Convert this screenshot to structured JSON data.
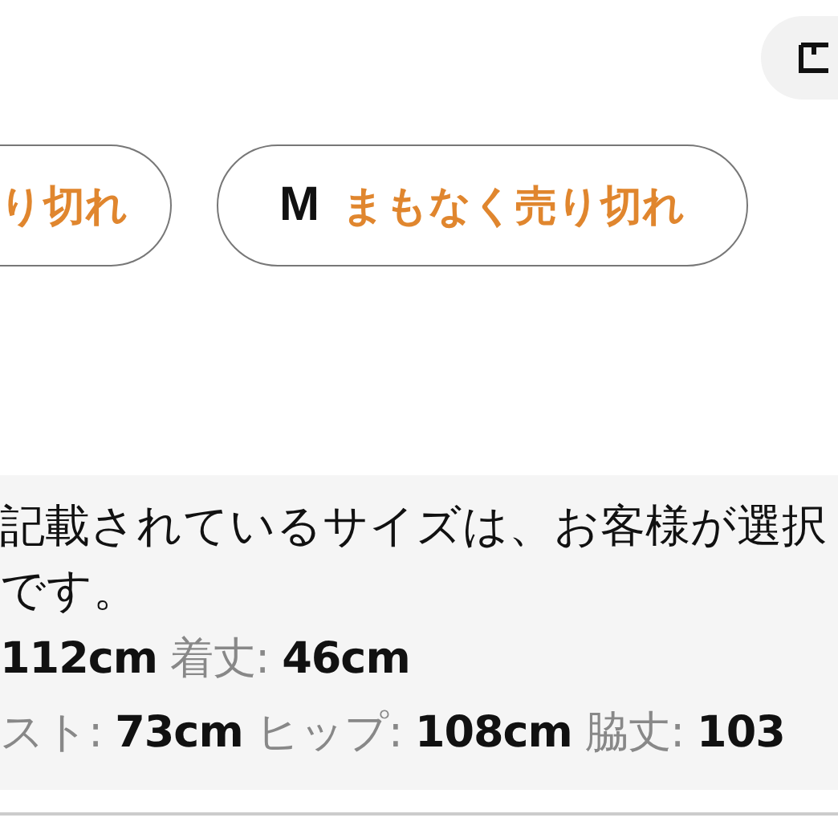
{
  "size_options": [
    {
      "status": "り切れ"
    },
    {
      "size": "M",
      "status": "まもなく売り切れ"
    }
  ],
  "note": {
    "lines": [
      "記載されているサイズは、お客様が選択",
      "です。"
    ]
  },
  "measurements": [
    [
      {
        "value": "112cm"
      },
      {
        "label": "着丈:",
        "value": "46cm"
      }
    ],
    [
      {
        "label": "スト:",
        "value": "73cm"
      },
      {
        "label": "ヒップ:",
        "value": "108cm"
      },
      {
        "label": "脇丈:",
        "value": "103"
      }
    ]
  ]
}
